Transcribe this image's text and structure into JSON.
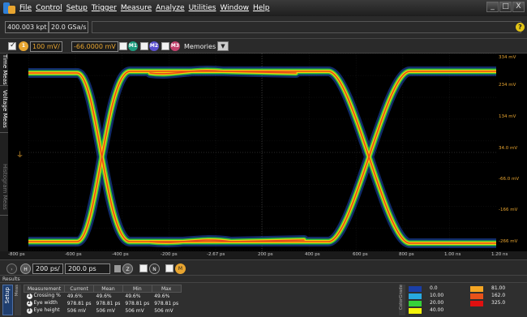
{
  "menu": {
    "items": [
      "File",
      "Control",
      "Setup",
      "Trigger",
      "Measure",
      "Analyze",
      "Utilities",
      "Window",
      "Help"
    ]
  },
  "window_buttons": [
    "_",
    "□",
    "X"
  ],
  "acquisition": {
    "memory_depth": "400.003 kpt",
    "sample_rate": "20.0 GSa/s",
    "help_icon": "?"
  },
  "channel_bar": {
    "channel_badge": "1",
    "scale": "100 mV/",
    "offset": "-66.0000 mV",
    "math_badges": [
      "M1",
      "M2",
      "M3"
    ],
    "memories_label": "Memories"
  },
  "side_tabs": [
    "Time Meas",
    "Voltage Meas",
    "Histogram Meas"
  ],
  "y_axis_labels": [
    "334 mV",
    "234 mV",
    "134 mV",
    "34.0 mV",
    "-66.0 mV",
    "-166 mV",
    "-266 mV"
  ],
  "x_axis_labels": [
    "-800 ps",
    "-600 ps",
    "-400 ps",
    "-200 ps",
    "-2.67 ps",
    "200 ps",
    "400 ps",
    "600 ps",
    "800 ps",
    "1.00 ns",
    "1.20 ns"
  ],
  "timebase": {
    "scale": "200 ps/",
    "position": "200.0 ps",
    "h_badge": "H",
    "z_badge": "Z",
    "n_badge": "N",
    "m_badge": "M"
  },
  "results": {
    "header": "Results",
    "setup_tab": "Setup",
    "meas_tab": "Meas",
    "columns": [
      "Measurement",
      "Current",
      "Mean",
      "Min",
      "Max"
    ],
    "rows": [
      {
        "num": "1",
        "name": "Crossing %",
        "current": "49.6%",
        "mean": "49.6%",
        "min": "49.6%",
        "max": "49.6%"
      },
      {
        "num": "2",
        "name": "Eye width",
        "current": "978.81 ps",
        "mean": "978.81 ps",
        "min": "978.81 ps",
        "max": "978.81 ps"
      },
      {
        "num": "3",
        "name": "Eye height",
        "current": "506 mV",
        "mean": "506 mV",
        "min": "506 mV",
        "max": "506 mV"
      }
    ]
  },
  "color_grade": {
    "tab": "ColorGrade",
    "entries": [
      {
        "color": "#1a3fa8",
        "value": "0.0"
      },
      {
        "color": "#27a9e0",
        "value": "10.00"
      },
      {
        "color": "#35d13a",
        "value": "20.00"
      },
      {
        "color": "#f2f20a",
        "value": "40.00"
      },
      {
        "color": "#f5a623",
        "value": "81.00"
      },
      {
        "color": "#e8521a",
        "value": "162.0"
      },
      {
        "color": "#e01010",
        "value": "325.0"
      }
    ]
  },
  "colors": {
    "channel": "#e8a530",
    "accent": "#e2c415"
  }
}
